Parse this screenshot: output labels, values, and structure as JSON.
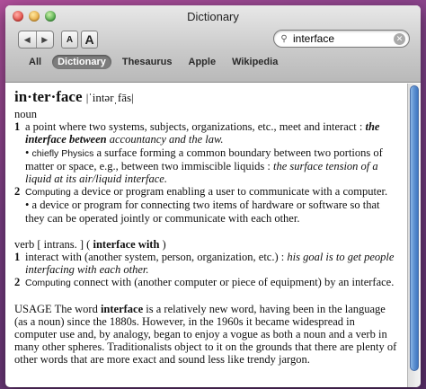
{
  "window": {
    "title": "Dictionary"
  },
  "toolbar": {
    "back_glyph": "◀",
    "forward_glyph": "▶",
    "font_small_label": "A",
    "font_large_label": "A",
    "search_value": "interface",
    "search_icon": "⚲",
    "clear_glyph": "✕"
  },
  "tabs": [
    "All",
    "Dictionary",
    "Thesaurus",
    "Apple",
    "Wikipedia"
  ],
  "entry": {
    "headword": "in·ter·face",
    "pronunciation": "|ˈintərˌfās|",
    "noun": {
      "pos": "noun",
      "s1": {
        "num": "1",
        "text": "a point where two systems, subjects, organizations, etc., meet and interact",
        "colon": " :",
        "ex_bold": "the interface between",
        "ex_rest": " accountancy and the law."
      },
      "s1b": {
        "bullet": "• ",
        "subject": "chiefly Physics",
        "text": " a surface forming a common boundary between two portions of matter or space, e.g., between two immiscible liquids",
        "colon": " : ",
        "ex": "the surface tension of a liquid at its air/liquid interface."
      },
      "s2": {
        "num": "2",
        "subject": "Computing",
        "text": " a device or program enabling a user to communicate with a computer."
      },
      "s2b": {
        "bullet": "• ",
        "text": "a device or program for connecting two items of hardware or software so that they can be operated jointly or communicate with each other."
      }
    },
    "verb": {
      "pos_line_a": "verb [ intrans. ] ( ",
      "pos_word": "interface with",
      "pos_line_b": " )",
      "s1": {
        "num": "1",
        "text": "interact with (another system, person, organization, etc.)",
        "colon": " : ",
        "ex": "his goal is to get people interfacing with each other."
      },
      "s2": {
        "num": "2",
        "subject": "Computing",
        "text": " connect with (another computer or piece of equipment) by an interface."
      }
    },
    "usage": {
      "label": "USAGE",
      "text_a": " The word ",
      "word": "interface",
      "text_b": " is a relatively new word, having been in the language (as a noun) since the 1880s. However, in the 1960s it became widespread in computer use and, by analogy, began to enjoy a vogue as both a noun and a verb in many other spheres. Traditionalists object to it on the grounds that there are plenty of other words that are more exact and sound less like trendy jargon."
    }
  }
}
